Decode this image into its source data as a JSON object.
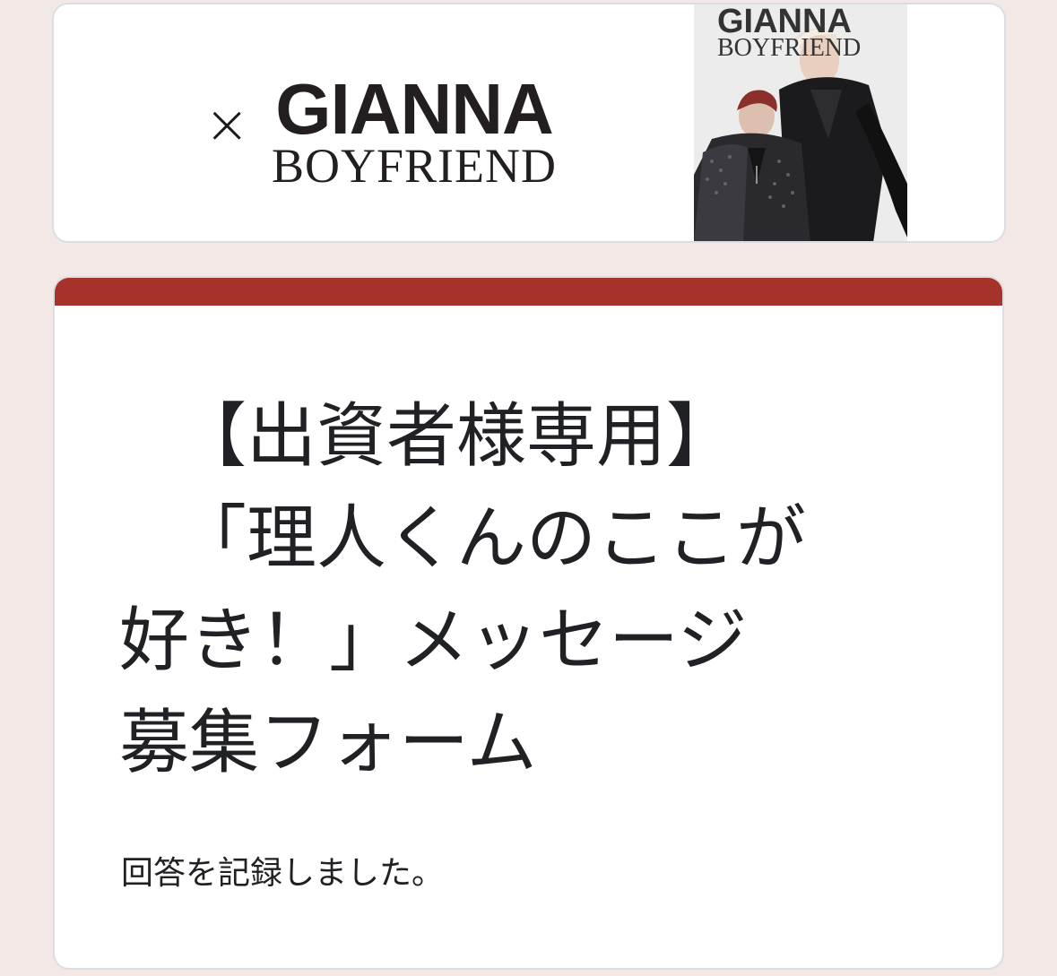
{
  "banner": {
    "times_symbol": "×",
    "logo_line1": "GIANNA",
    "logo_line2": "BOYFRIEND",
    "cover_line1": "GIANNA",
    "cover_line2": "BOYFRIEND"
  },
  "form": {
    "accent_color": "#a63329",
    "title_lines": [
      "【出資者様専用】",
      "「理人くんのここが",
      "好き！」メッセージ",
      "募集フォーム"
    ],
    "confirmation": "回答を記録しました。"
  }
}
